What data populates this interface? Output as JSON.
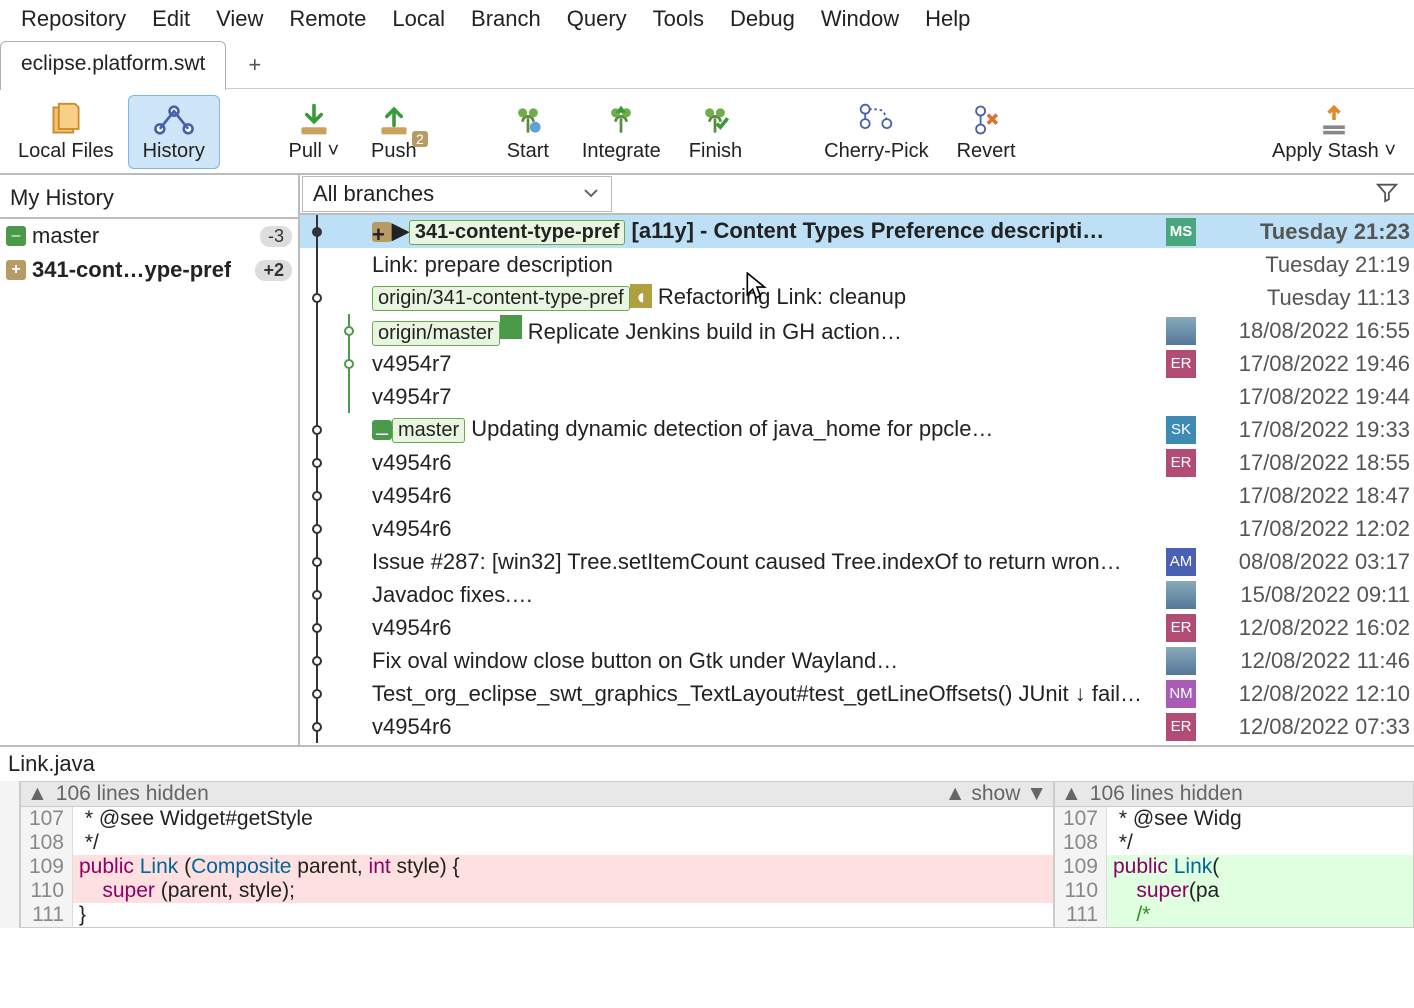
{
  "menubar": [
    "Repository",
    "Edit",
    "View",
    "Remote",
    "Local",
    "Branch",
    "Query",
    "Tools",
    "Debug",
    "Window",
    "Help"
  ],
  "tab": {
    "name": "eclipse.platform.swt"
  },
  "toolbar": {
    "local_files": "Local Files",
    "history": "History",
    "pull": "Pull ˅",
    "push": "Push",
    "push_badge": "2",
    "start": "Start",
    "integrate": "Integrate",
    "finish": "Finish",
    "cherry_pick": "Cherry-Pick",
    "revert": "Revert",
    "apply_stash": "Apply Stash ˅"
  },
  "sidebar": {
    "title": "My History",
    "items": [
      {
        "chip": "green",
        "label": "master",
        "badge": "-3"
      },
      {
        "chip": "gold",
        "label": "341-cont…ype-pref",
        "badge": "+2",
        "selected": true
      }
    ]
  },
  "branch_filter": "All branches",
  "commits": [
    {
      "node": "filled",
      "chips": [
        {
          "t": "341-content-type-pref",
          "cls": "chip-local",
          "pre": "gold-plus-tri"
        }
      ],
      "msg": "[a11y] - Content Types Preference descripti…",
      "avatar": {
        "txt": "MS",
        "bg": "#49a77f"
      },
      "time": "Tuesday 21:23",
      "sel": true
    },
    {
      "node": "line",
      "msg": "Link: prepare description",
      "time": "Tuesday 21:19"
    },
    {
      "node": "open",
      "chips": [
        {
          "t": "origin/341-content-type-pref",
          "cls": "chip-remote",
          "post": "yellow-half"
        }
      ],
      "msg": "Refactoring Link: cleanup",
      "time": "Tuesday 11:13"
    },
    {
      "node": "line2open",
      "chips": [
        {
          "t": "origin/master",
          "cls": "chip-remote",
          "post": "green-half"
        }
      ],
      "msg": "Replicate Jenkins build in GH action…",
      "avatar": {
        "img": true
      },
      "time": "18/08/2022 16:55"
    },
    {
      "node": "line2open",
      "msg": "v4954r7",
      "avatar": {
        "txt": "ER",
        "bg": "#b24c74"
      },
      "time": "17/08/2022 19:46"
    },
    {
      "node": "line2",
      "msg": "v4954r7",
      "time": "17/08/2022 19:44"
    },
    {
      "node": "open",
      "chips": [
        {
          "t": "master",
          "cls": "chip-local",
          "pre": "green-minus"
        }
      ],
      "msg": "Updating dynamic detection of java_home for ppcle…",
      "avatar": {
        "txt": "SK",
        "bg": "#3d8bb5"
      },
      "time": "17/08/2022 19:33"
    },
    {
      "node": "open",
      "msg": "v4954r6",
      "avatar": {
        "txt": "ER",
        "bg": "#b24c74"
      },
      "time": "17/08/2022 18:55"
    },
    {
      "node": "open",
      "msg": "v4954r6",
      "time": "17/08/2022 18:47"
    },
    {
      "node": "open",
      "msg": "v4954r6",
      "time": "17/08/2022 12:02"
    },
    {
      "node": "open",
      "msg": "Issue #287: [win32] Tree.setItemCount caused Tree.indexOf to return wron…",
      "avatar": {
        "txt": "AM",
        "bg": "#4a60b2"
      },
      "time": "08/08/2022 03:17"
    },
    {
      "node": "open",
      "msg": "Javadoc fixes.…",
      "avatar": {
        "img": true
      },
      "time": "15/08/2022 09:11"
    },
    {
      "node": "open",
      "msg": "v4954r6",
      "avatar": {
        "txt": "ER",
        "bg": "#b24c74"
      },
      "time": "12/08/2022 16:02"
    },
    {
      "node": "open",
      "msg": "Fix oval window close button on Gtk under Wayland…",
      "avatar": {
        "img": true
      },
      "time": "12/08/2022 11:46"
    },
    {
      "node": "open",
      "msg": "Test_org_eclipse_swt_graphics_TextLayout#test_getLineOffsets() JUnit ↓ fail…",
      "avatar": {
        "txt": "NM",
        "bg": "#a85cb5"
      },
      "time": "12/08/2022 12:10"
    },
    {
      "node": "open",
      "msg": "v4954r6",
      "avatar": {
        "txt": "ER",
        "bg": "#b24c74"
      },
      "time": "12/08/2022 07:33"
    }
  ],
  "diff": {
    "file": "Link.java",
    "hidden_text": "106 lines hidden",
    "show_text": "show",
    "left_start": 107,
    "right_start": 107,
    "left": [
      " * @see Widget#getStyle",
      " */",
      "public Link (Composite parent, int style) {",
      "    super (parent, style);",
      "}"
    ],
    "right": [
      " * @see Widg",
      " */",
      "public Link(",
      "    super(pa",
      "    /*"
    ]
  }
}
